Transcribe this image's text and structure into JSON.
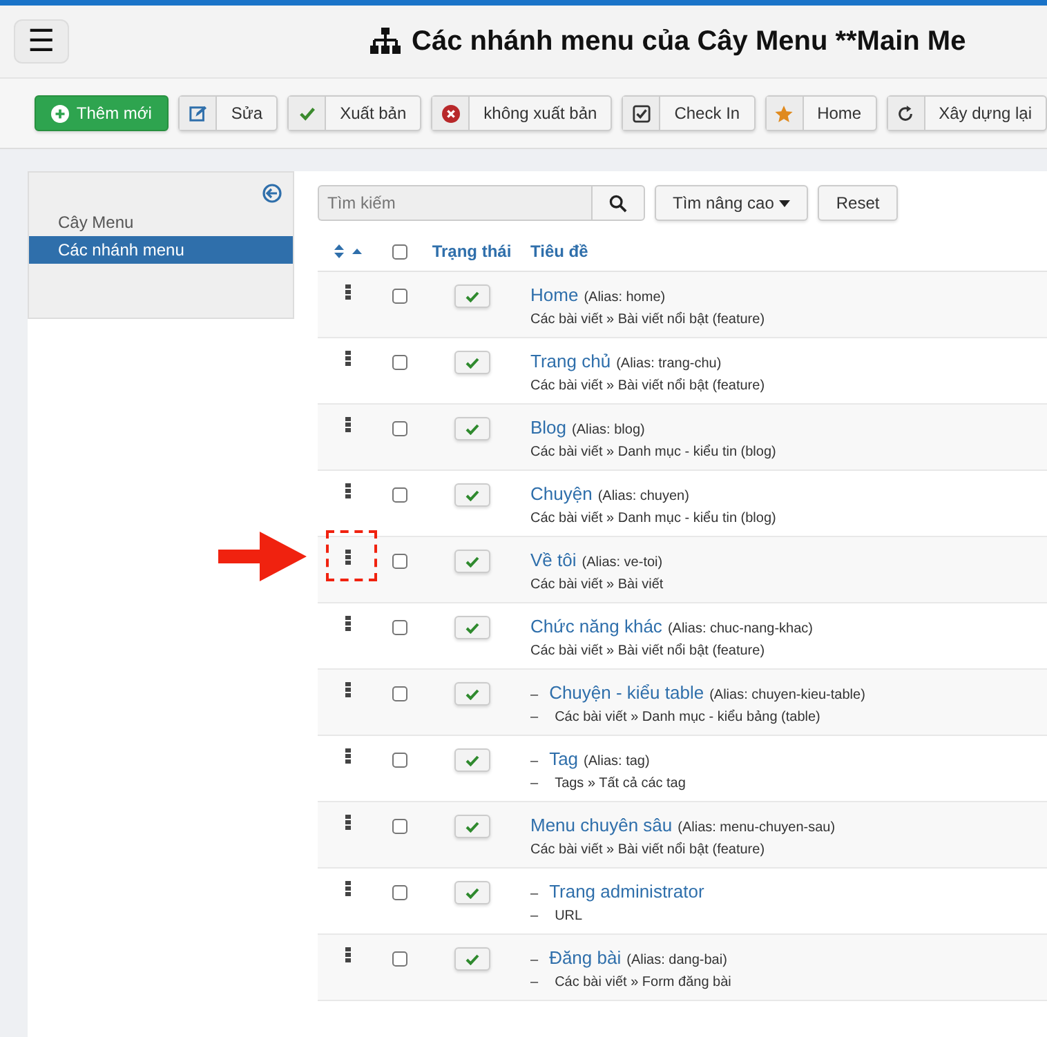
{
  "header": {
    "menu_button": "☰",
    "title": "Các nhánh menu của Cây Menu **Main Me"
  },
  "toolbar": [
    {
      "kind": "new",
      "label": "Thêm mới"
    },
    {
      "kind": "edit",
      "label": "Sửa"
    },
    {
      "kind": "publish",
      "label": "Xuất bản"
    },
    {
      "kind": "unpublish",
      "label": "không xuất bản"
    },
    {
      "kind": "checkin",
      "label": "Check In"
    },
    {
      "kind": "home",
      "label": "Home"
    },
    {
      "kind": "rebuild",
      "label": "Xây dựng lại"
    }
  ],
  "sidebar": {
    "items": [
      {
        "label": "Cây Menu",
        "selected": false
      },
      {
        "label": "Các nhánh menu",
        "selected": true
      }
    ]
  },
  "search": {
    "placeholder": "Tìm kiếm",
    "advanced": "Tìm nâng cao",
    "reset": "Reset"
  },
  "table": {
    "select_all": {
      "checked": false
    },
    "columns": [
      "Trạng thái",
      "Tiêu đề"
    ],
    "rows": [
      {
        "title": "Home",
        "alias": "(Alias: home)",
        "type": "Các bài viết » Bài viết nổi bật (feature)",
        "checked": false,
        "published": true,
        "highlighted": false
      },
      {
        "title": "Trang chủ",
        "alias": "(Alias: trang-chu)",
        "type": "Các bài viết » Bài viết nổi bật (feature)",
        "checked": false,
        "published": true,
        "highlighted": false
      },
      {
        "title": "Blog",
        "alias": "(Alias: blog)",
        "type": "Các bài viết » Danh mục - kiểu tin (blog)",
        "checked": false,
        "published": true,
        "highlighted": false
      },
      {
        "title": "Chuyện",
        "alias": "(Alias: chuyen)",
        "type": "Các bài viết » Danh mục - kiểu tin (blog)",
        "checked": false,
        "published": true,
        "highlighted": false
      },
      {
        "title": "Về tôi",
        "alias": "(Alias: ve-toi)",
        "type": "Các bài viết » Bài viết",
        "checked": false,
        "published": true,
        "highlighted": true
      },
      {
        "title": "Chức năng khác",
        "alias": "(Alias: chuc-nang-khac)",
        "type": "Các bài viết » Bài viết nổi bật (feature)",
        "checked": false,
        "published": true,
        "highlighted": false,
        "children": [
          {
            "title_marker": "–",
            "title": "Chuyện - kiểu table",
            "alias": "(Alias: chuyen-kieu-table)",
            "type_marker": "–",
            "type": "Các bài viết » Danh mục - kiểu bảng (table)",
            "checked": false,
            "published": true,
            "highlighted": false
          },
          {
            "title_marker": "–",
            "title": "Tag",
            "alias": "(Alias: tag)",
            "type_marker": "–",
            "type": "Tags » Tất cả các tag",
            "checked": false,
            "published": true,
            "highlighted": false
          }
        ]
      },
      {
        "title": "Menu chuyên sâu",
        "alias": "(Alias: menu-chuyen-sau)",
        "type": "Các bài viết » Bài viết nổi bật (feature)",
        "checked": false,
        "published": true,
        "highlighted": false,
        "children": [
          {
            "title_marker": "–",
            "title": "Trang administrator",
            "type_marker": "–",
            "type": "URL",
            "checked": false,
            "published": true,
            "highlighted": false
          },
          {
            "title_marker": "–",
            "title": "Đăng bài",
            "alias": "(Alias: dang-bai)",
            "type_marker": "–",
            "type": "Các bài viết » Form đăng bài",
            "checked": false,
            "published": true,
            "highlighted": false
          }
        ]
      }
    ]
  }
}
